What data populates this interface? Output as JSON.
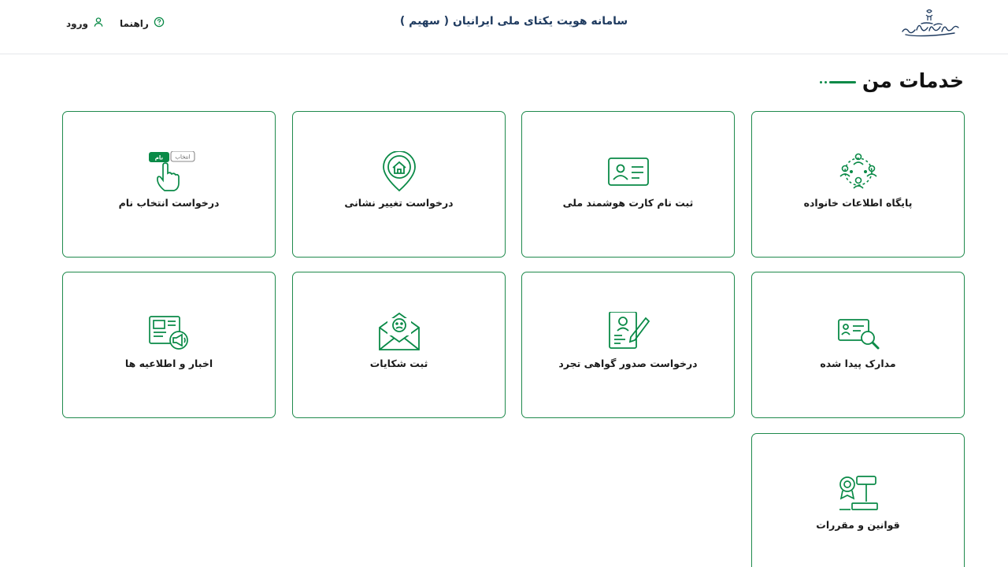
{
  "header": {
    "logo_text": "سازمان ثبت احوال کشور",
    "title_prefix": "سامانه هویت یکتای ملی ایرانیان ( ",
    "title_brand": "سهیم",
    "title_suffix": " )",
    "help_label": "راهنما",
    "login_label": "ورود"
  },
  "section": {
    "title": "خدمات من"
  },
  "services": [
    {
      "label": "پایگاه اطلاعات خانواده",
      "icon": "family-network-icon"
    },
    {
      "label": "ثبت نام کارت هوشمند ملی",
      "icon": "id-card-icon"
    },
    {
      "label": "درخواست تغییر نشانی",
      "icon": "home-location-icon"
    },
    {
      "label": "درخواست انتخاب نام",
      "icon": "name-select-hand-icon",
      "tag_top": "انتخاب",
      "tag_bottom": "نام"
    },
    {
      "label": "مدارک پیدا شده",
      "icon": "document-search-icon"
    },
    {
      "label": "درخواست صدور گواهی تجرد",
      "icon": "certificate-edit-icon"
    },
    {
      "label": "ثبت شکایات",
      "icon": "complaint-envelope-icon"
    },
    {
      "label": "اخبار و اطلاعیه ها",
      "icon": "newspaper-megaphone-icon"
    },
    {
      "label": "قوانین و مقررات",
      "icon": "law-gavel-icon"
    }
  ],
  "colors": {
    "accent": "#0a8a47",
    "border": "#1f8a4c",
    "title": "#1e3a5f"
  }
}
